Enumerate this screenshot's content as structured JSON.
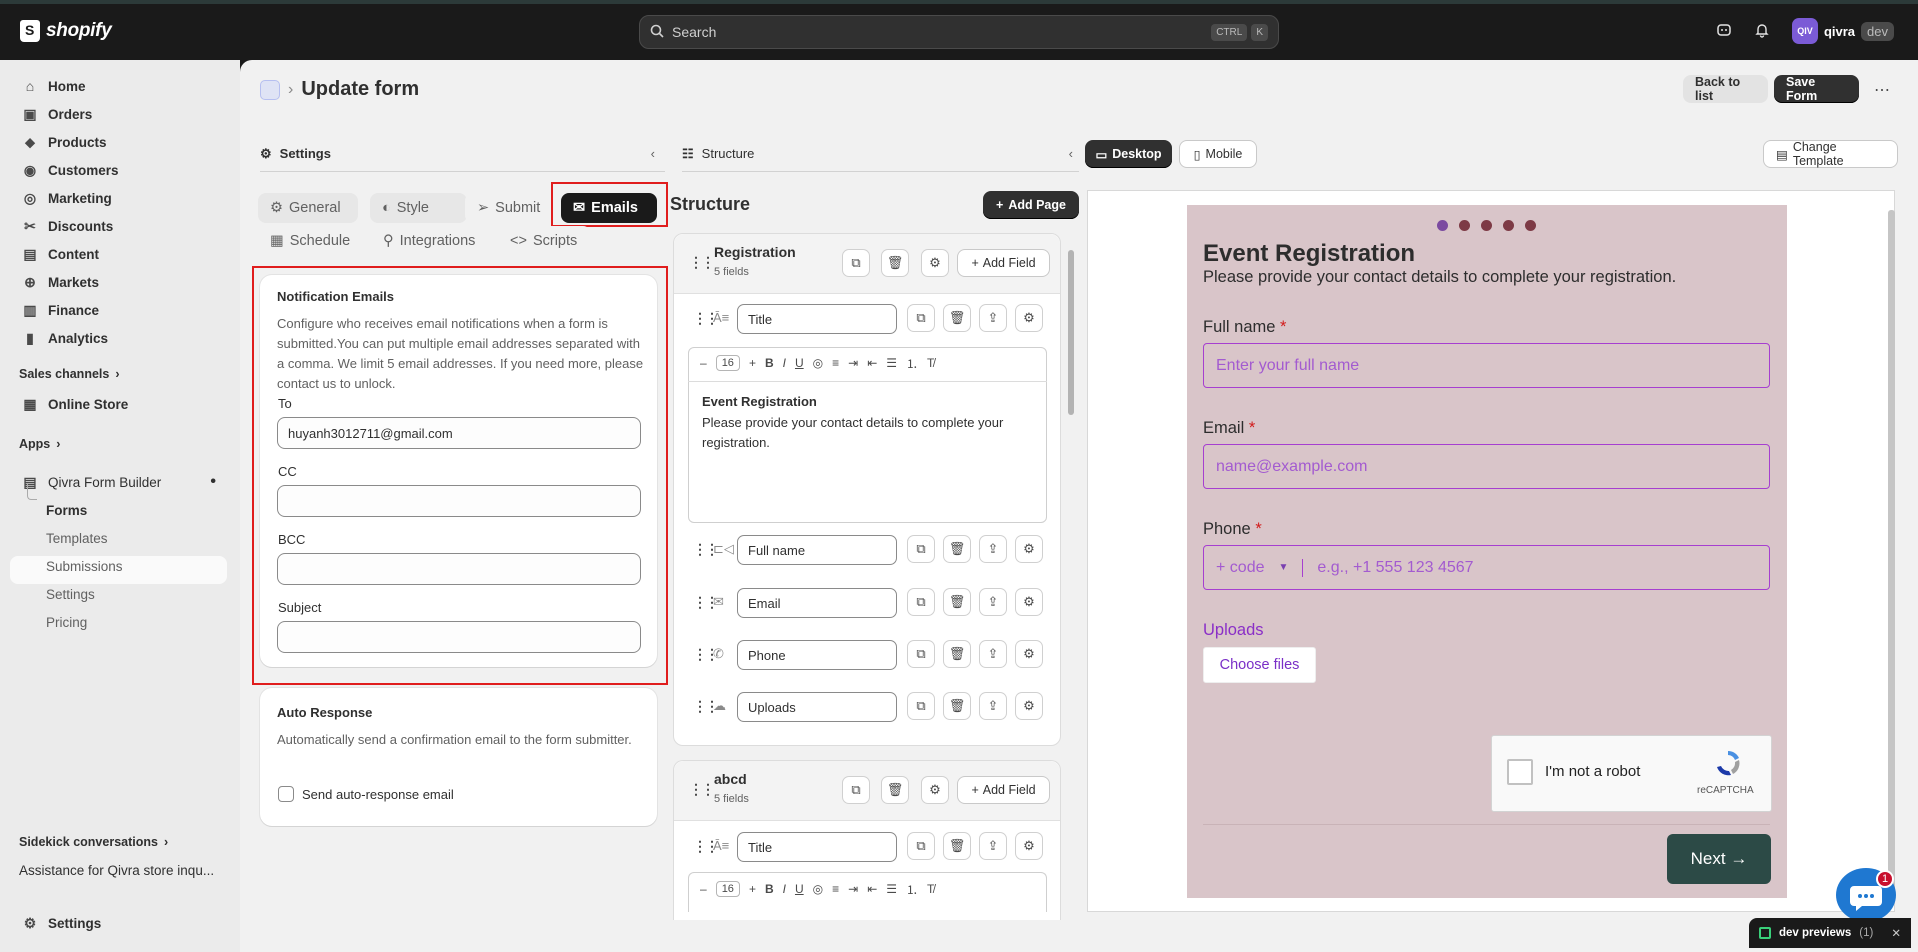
{
  "app": {
    "brand": "shopify"
  },
  "search": {
    "placeholder": "Search",
    "kbd1": "CTRL",
    "kbd2": "K"
  },
  "user": {
    "initials": "QIV",
    "store": "qivra",
    "env": "dev"
  },
  "sidebar": {
    "items": [
      {
        "label": "Home",
        "icon": "home-icon"
      },
      {
        "label": "Orders",
        "icon": "inbox-icon"
      },
      {
        "label": "Products",
        "icon": "tag-icon"
      },
      {
        "label": "Customers",
        "icon": "person-icon"
      },
      {
        "label": "Marketing",
        "icon": "target-icon"
      },
      {
        "label": "Discounts",
        "icon": "discount-icon"
      },
      {
        "label": "Content",
        "icon": "content-icon"
      },
      {
        "label": "Markets",
        "icon": "globe-icon"
      },
      {
        "label": "Finance",
        "icon": "bank-icon"
      },
      {
        "label": "Analytics",
        "icon": "chart-icon"
      }
    ],
    "sales_channels": "Sales channels",
    "online_store": "Online Store",
    "apps": "Apps",
    "app_name": "Qivra Form Builder",
    "app_items": [
      "Forms",
      "Templates",
      "Submissions",
      "Settings",
      "Pricing"
    ],
    "sidekick": "Sidekick conversations",
    "sidekick_item": "Assistance for Qivra store inqu...",
    "settings": "Settings"
  },
  "header": {
    "title": "Update form",
    "back": "Back to list",
    "save": "Save Form",
    "more": "⋯"
  },
  "settings_panel": {
    "title": "Settings",
    "tabs": [
      "General",
      "Style",
      "Submit",
      "Emails",
      "Schedule",
      "Integrations",
      "Scripts"
    ],
    "notification": {
      "title": "Notification Emails",
      "description": "Configure who receives email notifications when a form is submitted.You can put multiple email addresses separated with a comma. We limit 5 email addresses. If you need more, please contact us to unlock.",
      "to_label": "To",
      "to_value": "huyanh3012711@gmail.com",
      "cc_label": "CC",
      "bcc_label": "BCC",
      "subject_label": "Subject"
    },
    "auto": {
      "title": "Auto Response",
      "description": "Automatically send a confirmation email to the form submitter.",
      "checkbox": "Send auto-response email"
    }
  },
  "structure_panel": {
    "title": "Structure",
    "heading": "Structure",
    "add_page": "Add Page",
    "add_field": "Add Field",
    "font_size": "16",
    "pages": [
      {
        "name": "Registration",
        "count": "5 fields"
      },
      {
        "name": "abcd",
        "count": "5 fields"
      }
    ],
    "fields": [
      "Title",
      "Full name",
      "Email",
      "Phone",
      "Uploads"
    ],
    "rich_title": "Event Registration",
    "rich_body": "Please provide your contact details to complete your registration.",
    "field2_title": "Title"
  },
  "preview": {
    "desktop": "Desktop",
    "mobile": "Mobile",
    "change_template": "Change Template",
    "form_title": "Event Registration",
    "form_subtitle": "Please provide your contact details to complete your registration.",
    "full_name_label": "Full name",
    "full_name_ph": "Enter your full name",
    "email_label": "Email",
    "email_ph": "name@example.com",
    "phone_label": "Phone",
    "phone_code": "+ code",
    "phone_ph": "e.g., +1 555 123 4567",
    "uploads_label": "Uploads",
    "choose_files": "Choose files",
    "captcha": "I'm not a robot",
    "captcha_brand": "reCAPTCHA",
    "next": "Next →",
    "required_mark": "*"
  },
  "chat_badge": "1",
  "dev_previews": {
    "label": "dev previews",
    "count": "(1)"
  },
  "colors": {
    "accent_red": "#e01d1d",
    "form_bg": "#d9c5c9",
    "field_border": "#a63fd0",
    "next_btn": "#2c4a46"
  }
}
